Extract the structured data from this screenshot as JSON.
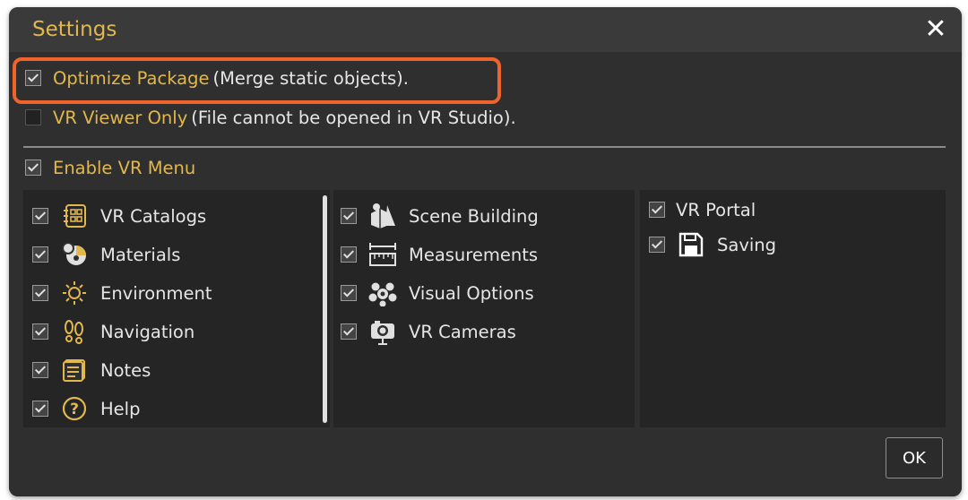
{
  "dialog": {
    "title": "Settings",
    "close_symbol": "✕"
  },
  "options": {
    "optimize_label": "Optimize Package",
    "optimize_desc": "(Merge static objects).",
    "optimize_checked": true,
    "viewer_label": "VR Viewer Only",
    "viewer_desc": "(File cannot be opened in VR Studio).",
    "viewer_checked": false,
    "enable_menu_label": "Enable VR Menu",
    "enable_menu_checked": true
  },
  "menu_columns": [
    [
      {
        "label": "VR Catalogs",
        "icon": "catalog-grid-icon",
        "checked": true
      },
      {
        "label": "Materials",
        "icon": "materials-sphere-icon",
        "checked": true
      },
      {
        "label": "Environment",
        "icon": "sun-icon",
        "checked": true
      },
      {
        "label": "Navigation",
        "icon": "footprints-icon",
        "checked": true
      },
      {
        "label": "Notes",
        "icon": "notes-icon",
        "checked": true
      },
      {
        "label": "Help",
        "icon": "help-icon",
        "checked": true
      }
    ],
    [
      {
        "label": "Scene Building",
        "icon": "shapes-icon",
        "checked": true
      },
      {
        "label": "Measurements",
        "icon": "ruler-icon",
        "checked": true
      },
      {
        "label": "Visual Options",
        "icon": "visual-options-icon",
        "checked": true
      },
      {
        "label": "VR Cameras",
        "icon": "camera-icon",
        "checked": true
      }
    ],
    [
      {
        "label": "VR Portal",
        "icon": "",
        "checked": true
      },
      {
        "label": "Saving",
        "icon": "floppy-disk-icon",
        "checked": true
      }
    ]
  ],
  "footer": {
    "ok_label": "OK"
  },
  "colors": {
    "accent_gold": "#e2b84d",
    "highlight_orange": "#f0632b",
    "dialog_bg": "#2f2f2f"
  }
}
